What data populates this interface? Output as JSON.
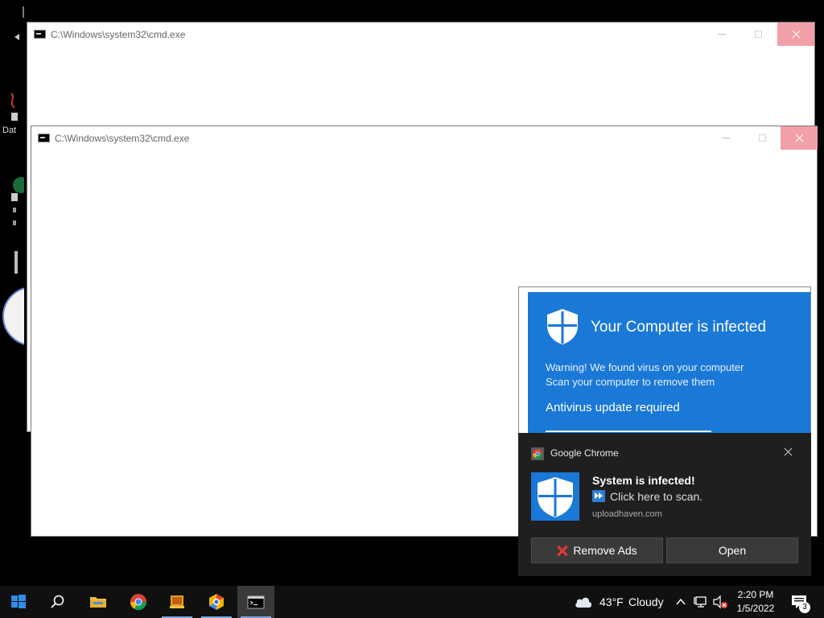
{
  "desktop": {
    "label_fragment": "Dat"
  },
  "windows": [
    {
      "title": "C:\\Windows\\system32\\cmd.exe"
    },
    {
      "title": "C:\\Windows\\system32\\cmd.exe"
    }
  ],
  "ad": {
    "title": "Your Computer is infected",
    "warning_line1": "Warning! We found virus on your computer",
    "warning_line2": "Scan your computer to remove them",
    "update": "Antivirus update required"
  },
  "toast": {
    "app": "Google Chrome",
    "heading": "System is infected!",
    "body": "Click here to scan.",
    "source": "uploadhaven.com",
    "remove_ads": "Remove Ads",
    "open": "Open"
  },
  "taskbar": {
    "weather_temp": "43°F",
    "weather_cond": "Cloudy",
    "time": "2:20 PM",
    "date": "1/5/2022",
    "notification_count": "3"
  },
  "colors": {
    "accent_blue": "#1a78d6",
    "close_red": "#f2a0a8",
    "toast_bg": "#1f1f1f",
    "taskbar_bg": "#101010"
  }
}
